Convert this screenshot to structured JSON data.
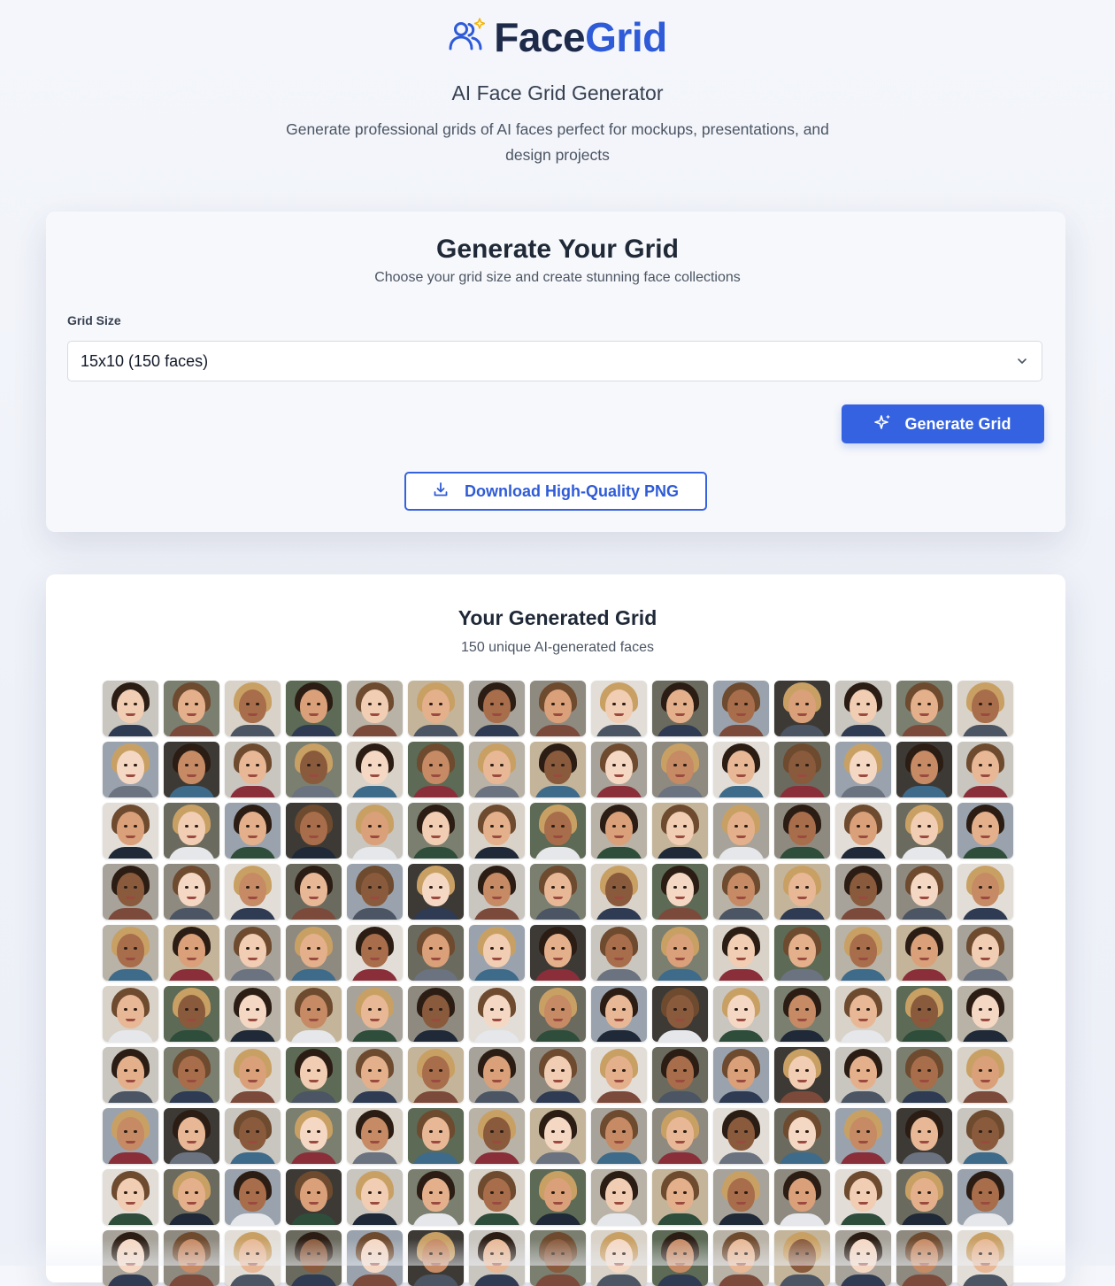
{
  "brand": {
    "name_part1": "Face",
    "name_part2": "Grid",
    "logo_icon": "users-sparkle-icon",
    "accent": "#2f5bd8"
  },
  "header": {
    "subtitle": "AI Face Grid Generator",
    "description": "Generate professional grids of AI faces perfect for mockups, presentations, and design projects"
  },
  "generator": {
    "title": "Generate Your Grid",
    "subtitle": "Choose your grid size and create stunning face collections",
    "grid_size_label": "Grid Size",
    "grid_size_value": "15x10 (150 faces)",
    "generate_button": "Generate Grid",
    "generate_icon": "sparkles-icon",
    "download_button": "Download High-Quality PNG",
    "download_icon": "download-icon"
  },
  "results": {
    "title": "Your Generated Grid",
    "count_text": "150 unique AI-generated faces",
    "columns": 15,
    "rows_visible": 10
  }
}
